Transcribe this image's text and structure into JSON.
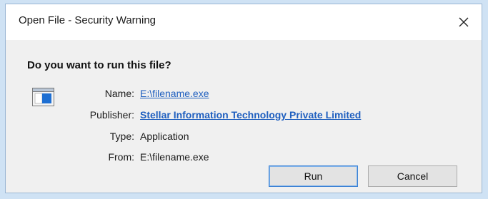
{
  "window": {
    "title": "Open File - Security Warning",
    "close_icon": "close-x-icon"
  },
  "question": "Do you want to run this file?",
  "file_icon": "executable-window-icon",
  "details": {
    "name_label": "Name:",
    "name_value": "E:\\filename.exe",
    "publisher_label": "Publisher:",
    "publisher_value": "Stellar Information Technology Private Limited",
    "type_label": "Type:",
    "type_value": "Application",
    "from_label": "From:",
    "from_value": "E:\\filename.exe"
  },
  "buttons": {
    "run_label": "Run",
    "cancel_label": "Cancel"
  },
  "colors": {
    "link": "#1f5fbf",
    "default_button_border": "#3c82d4",
    "background": "#cfe2f4"
  }
}
